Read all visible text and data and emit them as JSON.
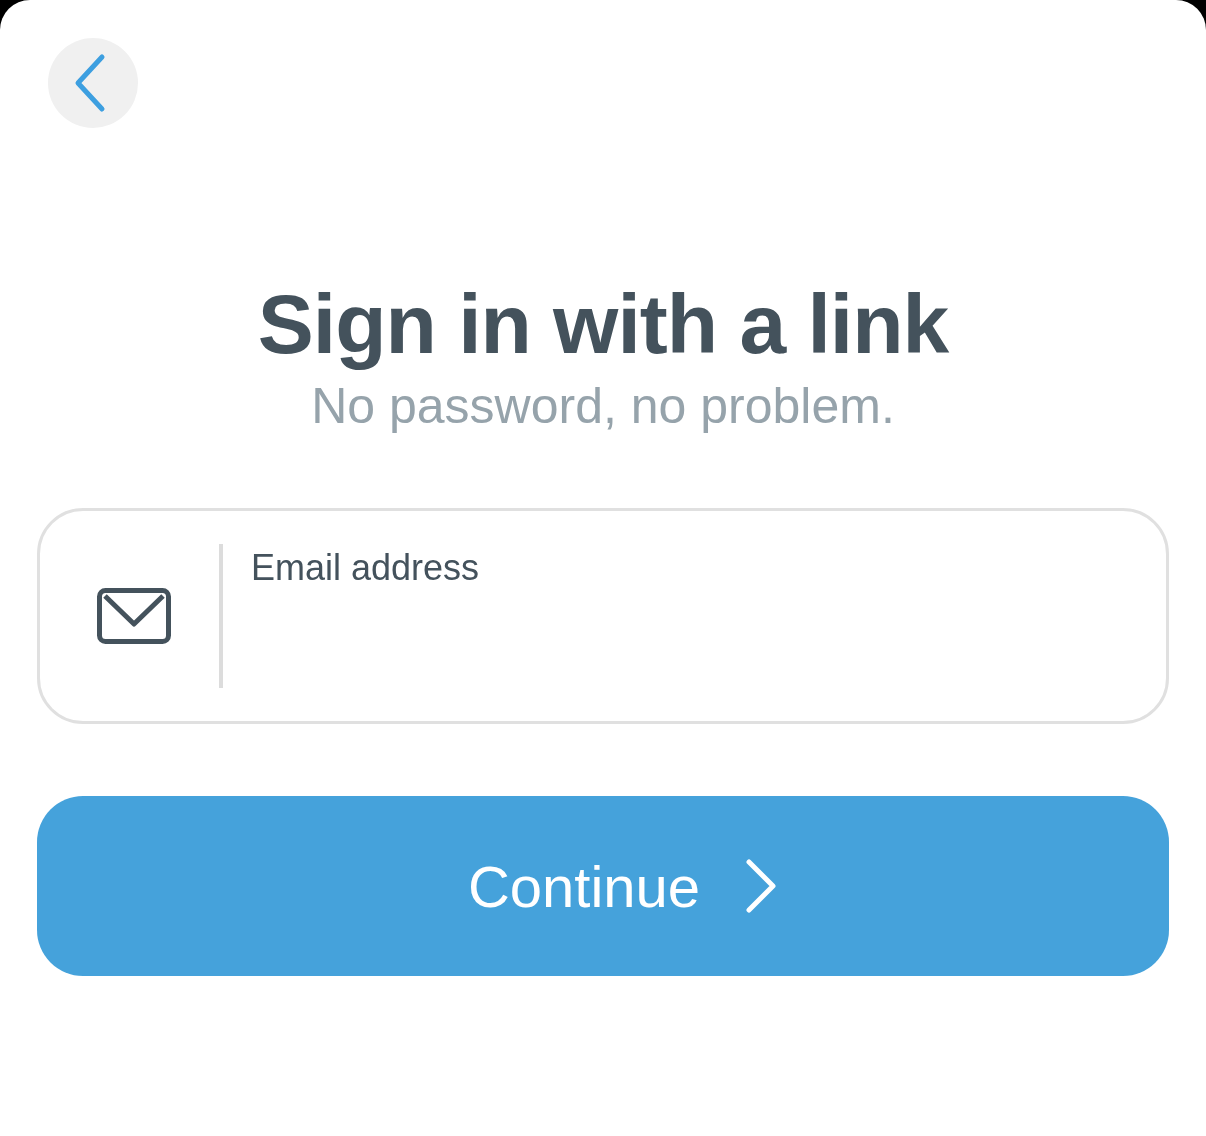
{
  "title": "Sign in with a link",
  "subtitle": "No password, no problem.",
  "email_field": {
    "label": "Email address"
  },
  "continue_button": {
    "label": "Continue"
  }
}
